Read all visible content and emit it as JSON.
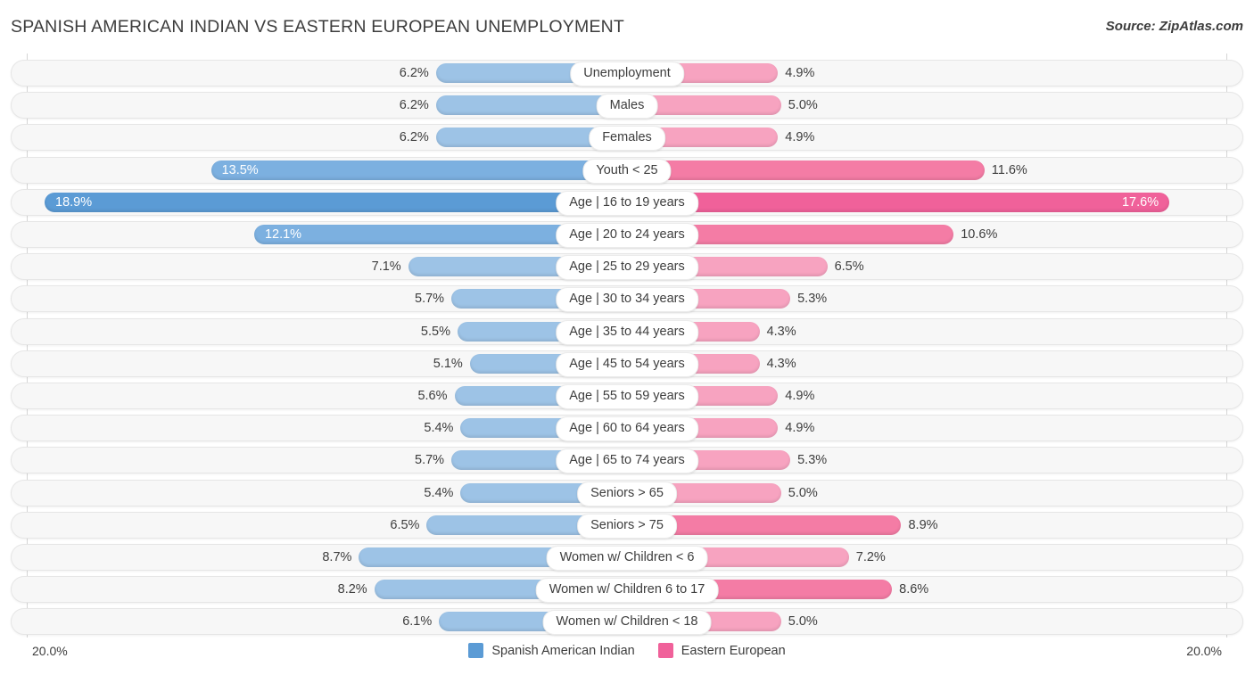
{
  "header": {
    "title": "SPANISH AMERICAN INDIAN VS EASTERN EUROPEAN UNEMPLOYMENT",
    "source": "Source: ZipAtlas.com"
  },
  "footer": {
    "axis_left_label": "20.0%",
    "axis_right_label": "20.0%"
  },
  "legend": {
    "items": [
      {
        "label": "Spanish American Indian",
        "color": "#5b9bd5"
      },
      {
        "label": "Eastern European",
        "color": "#f0619a"
      }
    ]
  },
  "colors": {
    "left_light": "#9dc3e6",
    "left_mid": "#7cb0e0",
    "left_dark": "#5b9bd5",
    "right_light": "#f7a3c0",
    "right_mid": "#f47ca5",
    "right_dark": "#f0619a",
    "track": "#f7f7f7",
    "track_border": "#e6e6e6",
    "text": "#3d3d3d"
  },
  "chart_data": {
    "type": "bar",
    "title": "SPANISH AMERICAN INDIAN VS EASTERN EUROPEAN UNEMPLOYMENT",
    "subtitle": "",
    "xlabel": "",
    "ylabel": "",
    "orientation": "horizontal-diverging",
    "axis_max": 20.0,
    "axis_unit": "%",
    "grid": false,
    "legend_position": "bottom-center",
    "categories": [
      "Unemployment",
      "Males",
      "Females",
      "Youth < 25",
      "Age | 16 to 19 years",
      "Age | 20 to 24 years",
      "Age | 25 to 29 years",
      "Age | 30 to 34 years",
      "Age | 35 to 44 years",
      "Age | 45 to 54 years",
      "Age | 55 to 59 years",
      "Age | 60 to 64 years",
      "Age | 65 to 74 years",
      "Seniors > 65",
      "Seniors > 75",
      "Women w/ Children < 6",
      "Women w/ Children 6 to 17",
      "Women w/ Children < 18"
    ],
    "series": [
      {
        "name": "Spanish American Indian",
        "color": "#5b9bd5",
        "values": [
          6.2,
          6.2,
          6.2,
          13.5,
          18.9,
          12.1,
          7.1,
          5.7,
          5.5,
          5.1,
          5.6,
          5.4,
          5.7,
          5.4,
          6.5,
          8.7,
          8.2,
          6.1
        ]
      },
      {
        "name": "Eastern European",
        "color": "#f0619a",
        "values": [
          4.9,
          5.0,
          4.9,
          11.6,
          17.6,
          10.6,
          6.5,
          5.3,
          4.3,
          4.3,
          4.9,
          4.9,
          5.3,
          5.0,
          8.9,
          7.2,
          8.6,
          5.0
        ]
      }
    ]
  },
  "rows": [
    {
      "label": "Unemployment",
      "left": "6.2%",
      "right": "4.9%",
      "lv": 6.2,
      "rv": 4.9,
      "lshade": "light",
      "rshade": "light",
      "linside": false,
      "rinside": false
    },
    {
      "label": "Males",
      "left": "6.2%",
      "right": "5.0%",
      "lv": 6.2,
      "rv": 5.0,
      "lshade": "light",
      "rshade": "light",
      "linside": false,
      "rinside": false
    },
    {
      "label": "Females",
      "left": "6.2%",
      "right": "4.9%",
      "lv": 6.2,
      "rv": 4.9,
      "lshade": "light",
      "rshade": "light",
      "linside": false,
      "rinside": false
    },
    {
      "label": "Youth < 25",
      "left": "13.5%",
      "right": "11.6%",
      "lv": 13.5,
      "rv": 11.6,
      "lshade": "mid",
      "rshade": "mid",
      "linside": true,
      "rinside": false
    },
    {
      "label": "Age | 16 to 19 years",
      "left": "18.9%",
      "right": "17.6%",
      "lv": 18.9,
      "rv": 17.6,
      "lshade": "dark",
      "rshade": "dark",
      "linside": true,
      "rinside": true
    },
    {
      "label": "Age | 20 to 24 years",
      "left": "12.1%",
      "right": "10.6%",
      "lv": 12.1,
      "rv": 10.6,
      "lshade": "mid",
      "rshade": "mid",
      "linside": true,
      "rinside": false
    },
    {
      "label": "Age | 25 to 29 years",
      "left": "7.1%",
      "right": "6.5%",
      "lv": 7.1,
      "rv": 6.5,
      "lshade": "light",
      "rshade": "light",
      "linside": false,
      "rinside": false
    },
    {
      "label": "Age | 30 to 34 years",
      "left": "5.7%",
      "right": "5.3%",
      "lv": 5.7,
      "rv": 5.3,
      "lshade": "light",
      "rshade": "light",
      "linside": false,
      "rinside": false
    },
    {
      "label": "Age | 35 to 44 years",
      "left": "5.5%",
      "right": "4.3%",
      "lv": 5.5,
      "rv": 4.3,
      "lshade": "light",
      "rshade": "light",
      "linside": false,
      "rinside": false
    },
    {
      "label": "Age | 45 to 54 years",
      "left": "5.1%",
      "right": "4.3%",
      "lv": 5.1,
      "rv": 4.3,
      "lshade": "light",
      "rshade": "light",
      "linside": false,
      "rinside": false
    },
    {
      "label": "Age | 55 to 59 years",
      "left": "5.6%",
      "right": "4.9%",
      "lv": 5.6,
      "rv": 4.9,
      "lshade": "light",
      "rshade": "light",
      "linside": false,
      "rinside": false
    },
    {
      "label": "Age | 60 to 64 years",
      "left": "5.4%",
      "right": "4.9%",
      "lv": 5.4,
      "rv": 4.9,
      "lshade": "light",
      "rshade": "light",
      "linside": false,
      "rinside": false
    },
    {
      "label": "Age | 65 to 74 years",
      "left": "5.7%",
      "right": "5.3%",
      "lv": 5.7,
      "rv": 5.3,
      "lshade": "light",
      "rshade": "light",
      "linside": false,
      "rinside": false
    },
    {
      "label": "Seniors > 65",
      "left": "5.4%",
      "right": "5.0%",
      "lv": 5.4,
      "rv": 5.0,
      "lshade": "light",
      "rshade": "light",
      "linside": false,
      "rinside": false
    },
    {
      "label": "Seniors > 75",
      "left": "6.5%",
      "right": "8.9%",
      "lv": 6.5,
      "rv": 8.9,
      "lshade": "light",
      "rshade": "mid",
      "linside": false,
      "rinside": false
    },
    {
      "label": "Women w/ Children < 6",
      "left": "8.7%",
      "right": "7.2%",
      "lv": 8.7,
      "rv": 7.2,
      "lshade": "light",
      "rshade": "light",
      "linside": false,
      "rinside": false
    },
    {
      "label": "Women w/ Children 6 to 17",
      "left": "8.2%",
      "right": "8.6%",
      "lv": 8.2,
      "rv": 8.6,
      "lshade": "light",
      "rshade": "mid",
      "linside": false,
      "rinside": false
    },
    {
      "label": "Women w/ Children < 18",
      "left": "6.1%",
      "right": "5.0%",
      "lv": 6.1,
      "rv": 5.0,
      "lshade": "light",
      "rshade": "light",
      "linside": false,
      "rinside": false
    }
  ]
}
